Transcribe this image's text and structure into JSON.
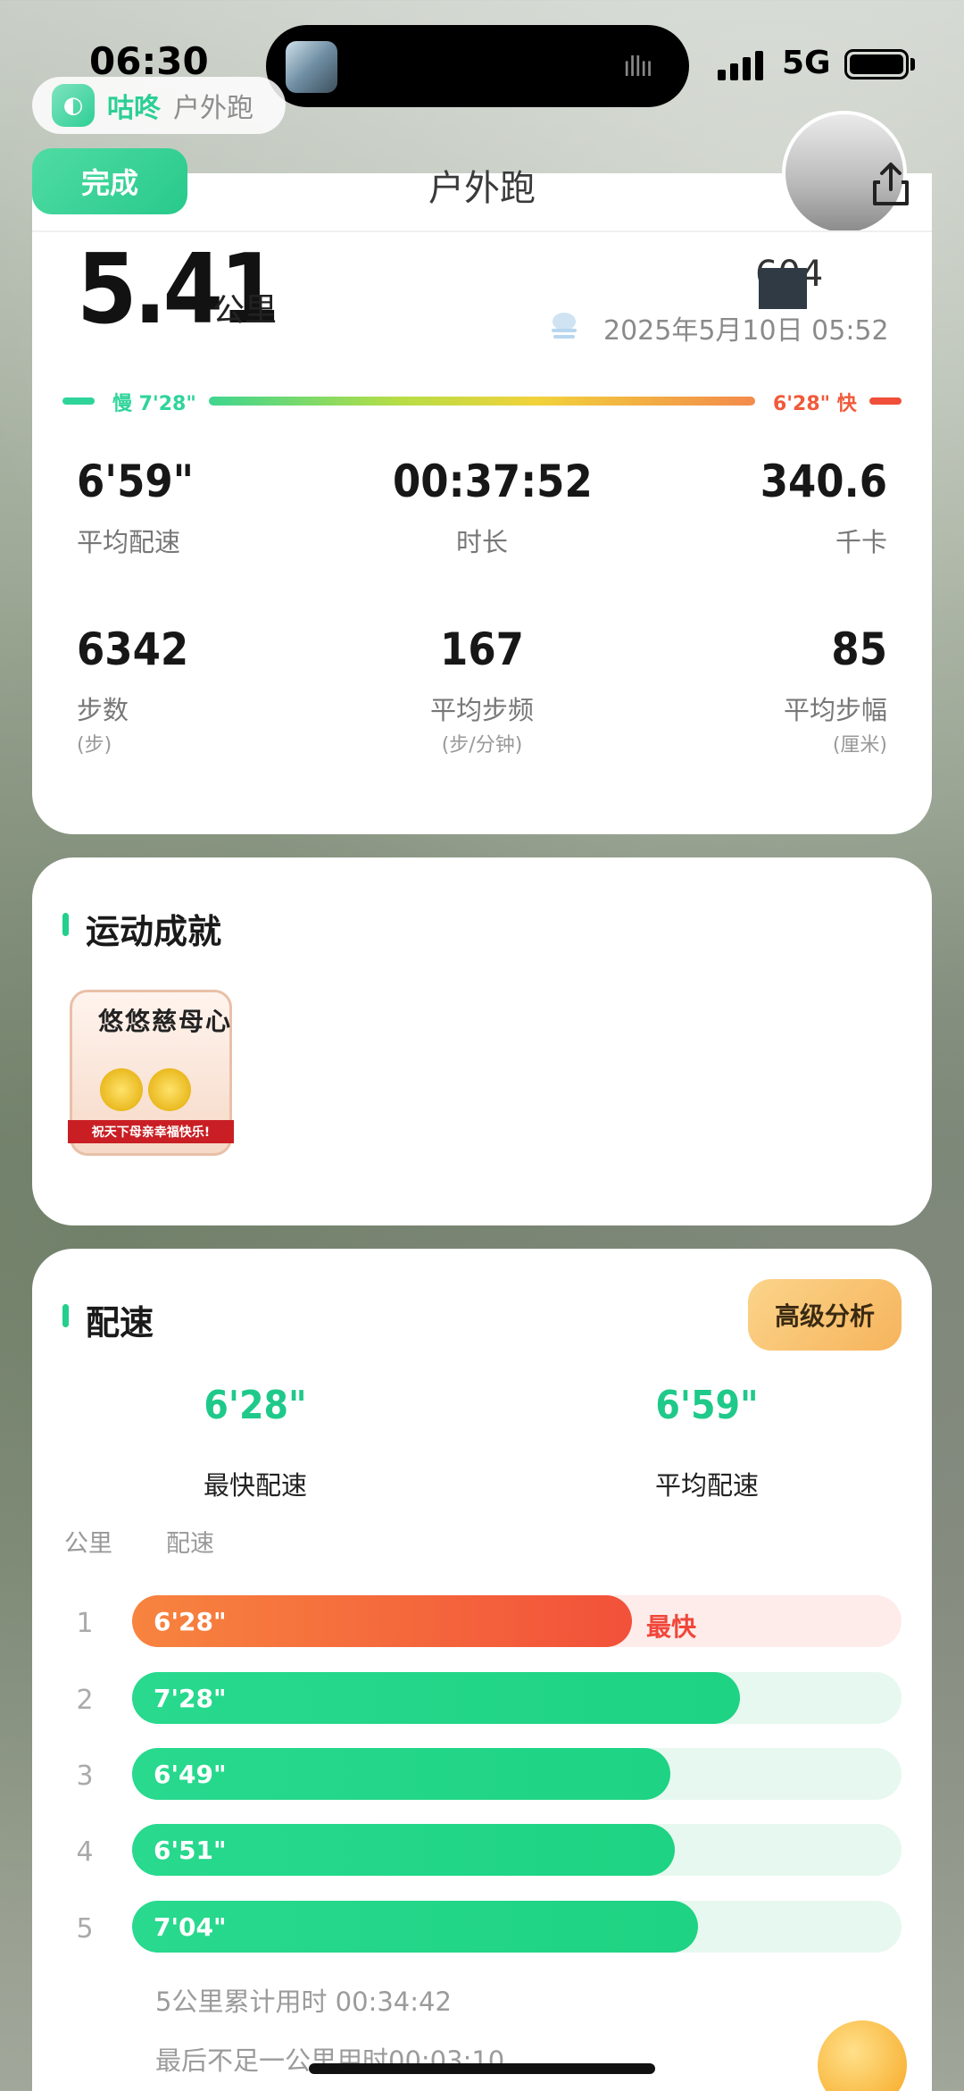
{
  "status": {
    "time": "06:30",
    "network": "5G"
  },
  "app": {
    "name": "咕咚",
    "subtitle": "户外跑"
  },
  "header": {
    "done_label": "完成",
    "title": "户外跑"
  },
  "summary": {
    "distance": "5.41",
    "distance_unit": "公里",
    "score_text": "604",
    "datetime": "2025年5月10日 05:52"
  },
  "pace_bar": {
    "slow_label": "慢 7'28\"",
    "fast_label": "6'28\" 快"
  },
  "stats": [
    {
      "value": "6'59\"",
      "label": "平均配速",
      "sub": ""
    },
    {
      "value": "00:37:52",
      "label": "时长",
      "sub": ""
    },
    {
      "value": "340.6",
      "label": "千卡",
      "sub": ""
    },
    {
      "value": "6342",
      "label": "步数",
      "sub": "(步)"
    },
    {
      "value": "167",
      "label": "平均步频",
      "sub": "(步/分钟)"
    },
    {
      "value": "85",
      "label": "平均步幅",
      "sub": "(厘米)"
    }
  ],
  "achievements": {
    "title": "运动成就",
    "medal_title": "悠悠慈母心",
    "medal_ribbon": "祝天下母亲幸福快乐!"
  },
  "pace_section": {
    "title": "配速",
    "advanced_label": "高级分析",
    "fastest_value": "6'28\"",
    "fastest_label": "最快配速",
    "average_value": "6'59\"",
    "average_label": "平均配速",
    "col_km": "公里",
    "col_pace": "配速",
    "fastest_tag": "最快",
    "rows": [
      {
        "km": "1",
        "pace": "6'28\"",
        "fraction": 0.65,
        "fastest": true
      },
      {
        "km": "2",
        "pace": "7'28\"",
        "fraction": 0.79,
        "fastest": false
      },
      {
        "km": "3",
        "pace": "6'49\"",
        "fraction": 0.7,
        "fastest": false
      },
      {
        "km": "4",
        "pace": "6'51\"",
        "fraction": 0.705,
        "fastest": false
      },
      {
        "km": "5",
        "pace": "7'04\"",
        "fraction": 0.735,
        "fastest": false
      }
    ],
    "cumulative": "5公里累计用时 00:34:42",
    "remainder": "最后不足一公里用时00:03:10"
  }
}
